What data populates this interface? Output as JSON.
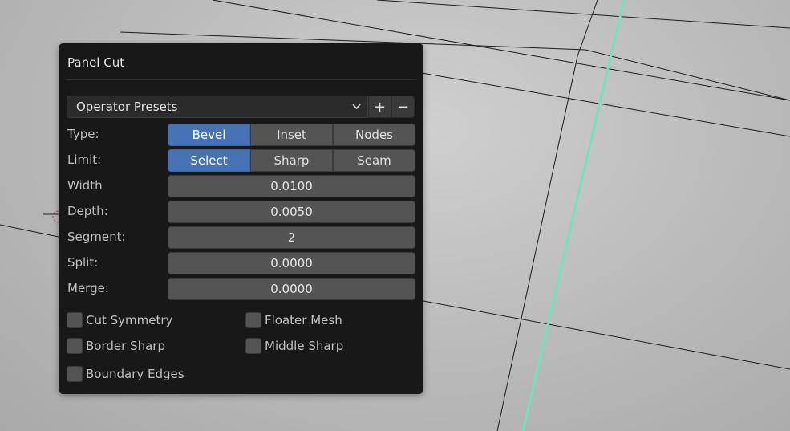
{
  "panel": {
    "title": "Panel Cut",
    "presets": {
      "label": "Operator Presets",
      "add": "+",
      "remove": "−"
    },
    "type": {
      "label": "Type:",
      "options": [
        "Bevel",
        "Inset",
        "Nodes"
      ],
      "selected": "Bevel"
    },
    "limit": {
      "label": "Limit:",
      "options": [
        "Select",
        "Sharp",
        "Seam"
      ],
      "selected": "Select"
    },
    "fields": [
      {
        "label": "Width",
        "value": "0.0100"
      },
      {
        "label": "Depth:",
        "value": "0.0050"
      },
      {
        "label": "Segment:",
        "value": "2"
      },
      {
        "label": "Split:",
        "value": "0.0000"
      },
      {
        "label": "Merge:",
        "value": "0.0000"
      }
    ],
    "checkboxes": [
      {
        "label": "Cut Symmetry",
        "checked": false
      },
      {
        "label": "Floater Mesh",
        "checked": false
      },
      {
        "label": "Border Sharp",
        "checked": false
      },
      {
        "label": "Middle Sharp",
        "checked": false
      },
      {
        "label": "Boundary Edges",
        "checked": false
      }
    ]
  },
  "colors": {
    "accent": "#4772b3",
    "selected_edge": "#6fe3c0",
    "panel_bg": "#181818"
  }
}
